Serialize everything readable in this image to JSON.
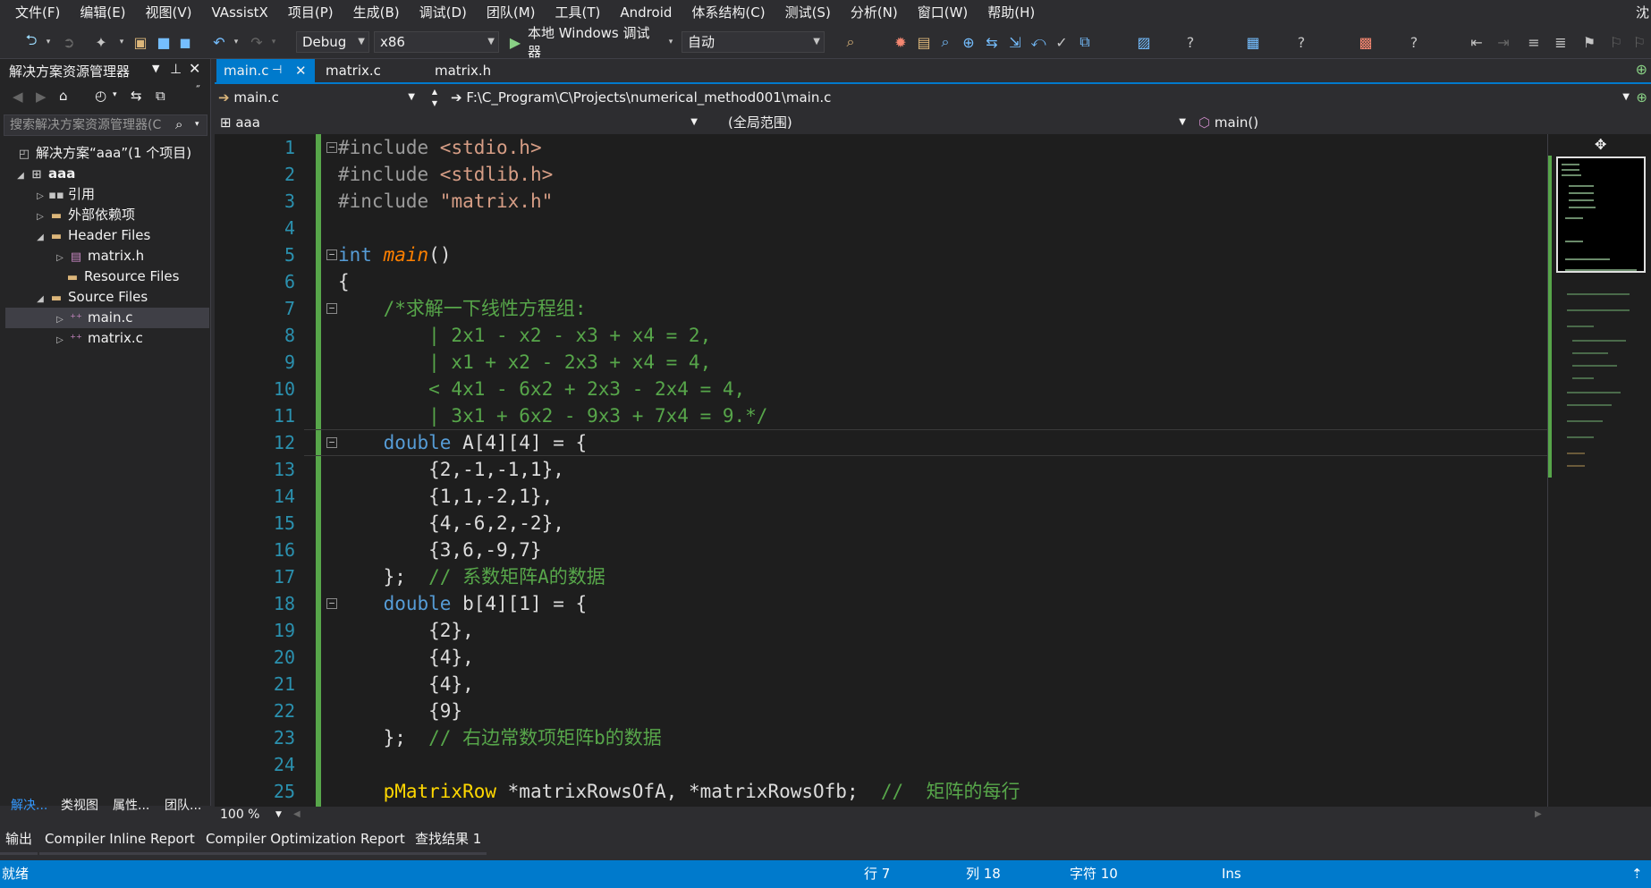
{
  "menu": [
    "文件(F)",
    "编辑(E)",
    "视图(V)",
    "VAssistX",
    "项目(P)",
    "生成(B)",
    "调试(D)",
    "团队(M)",
    "工具(T)",
    "Android",
    "体系结构(C)",
    "测试(S)",
    "分析(N)",
    "窗口(W)",
    "帮助(H)"
  ],
  "menu_right": "沈",
  "toolbar": {
    "config": "Debug",
    "platform": "x86",
    "run_label": "本地 Windows 调试器",
    "run_mode": "自动"
  },
  "solution_explorer": {
    "title": "解决方案资源管理器",
    "search_placeholder": "搜索解决方案资源管理器(C",
    "items": [
      {
        "label": "解决方案“aaa”(1 个项目)"
      },
      {
        "label": "aaa"
      },
      {
        "label": "引用"
      },
      {
        "label": "外部依赖项"
      },
      {
        "label": "Header Files"
      },
      {
        "label": "matrix.h"
      },
      {
        "label": "Resource Files"
      },
      {
        "label": "Source Files"
      },
      {
        "label": "main.c"
      },
      {
        "label": "matrix.c"
      }
    ],
    "footer_tabs": [
      "解决...",
      "类视图",
      "属性...",
      "团队..."
    ]
  },
  "tabs": [
    {
      "label": "main.c"
    },
    {
      "label": "matrix.c"
    },
    {
      "label": "matrix.h"
    }
  ],
  "nav": {
    "file": "main.c",
    "path": "F:\\C_Program\\C\\Projects\\numerical_method001\\main.c",
    "project": "aaa",
    "scope": "(全局范围)",
    "member": "main()"
  },
  "code": {
    "line_numbers": [
      "1",
      "2",
      "3",
      "4",
      "5",
      "6",
      "7",
      "8",
      "9",
      "10",
      "11",
      "12",
      "13",
      "14",
      "15",
      "16",
      "17",
      "18",
      "19",
      "20",
      "21",
      "22",
      "23",
      "24",
      "25"
    ],
    "l1a": "#include ",
    "l1b": "<stdio.h>",
    "l2a": "#include ",
    "l2b": "<stdlib.h>",
    "l3a": "#include ",
    "l3b": "\"matrix.h\"",
    "l5a": "int",
    "l5b": "main",
    "l5c": "()",
    "l6": "{",
    "l7": "    /*求解一下线性方程组:",
    "l8": "        | 2x1 - x2 - x3 + x4 = 2,",
    "l9": "        | x1 + x2 - 2x3 + x4 = 4,",
    "l10": "        < 4x1 - 6x2 + 2x3 - 2x4 = 4,",
    "l11": "        | 3x1 + 6x2 - 9x3 + 7x4 = 9.*/",
    "l12a": "    double",
    "l12b": " A[4][4] = {",
    "l13": "        {2,-1,-1,1},",
    "l14": "        {1,1,-2,1},",
    "l15": "        {4,-6,2,-2},",
    "l16": "        {3,6,-9,7}",
    "l17a": "    };  ",
    "l17b": "// 系数矩阵A的数据",
    "l18a": "    double",
    "l18b": " b[4][1] = {",
    "l19": "        {2},",
    "l20": "        {4},",
    "l21": "        {4},",
    "l22": "        {9}",
    "l23a": "    };  ",
    "l23b": "// 右边常数项矩阵b的数据",
    "l25a": "    pMatrixRow",
    "l25b": " *matrixRowsOfA, *matrixRowsOfb;  ",
    "l25c": "//  矩阵的每行"
  },
  "zoom": "100 %",
  "output_tabs": [
    "输出",
    "Compiler Inline Report",
    "Compiler Optimization Report",
    "查找结果 1"
  ],
  "status": {
    "ready": "就绪",
    "row": "行 7",
    "col": "列 18",
    "char": "字符 10",
    "ins": "Ins"
  },
  "colors": {
    "accent": "#007acc",
    "keyword": "#569cd6",
    "string": "#d69d85",
    "comment": "#57a64a",
    "type": "#ffd700",
    "function": "#ff8000",
    "linenumber": "#2b91af"
  }
}
